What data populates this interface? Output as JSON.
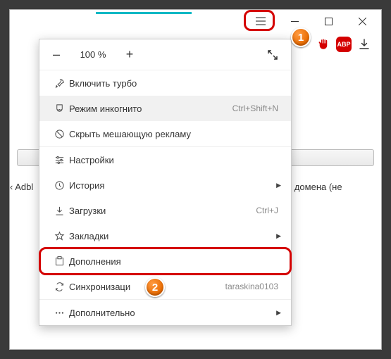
{
  "window": {
    "tab_active": true
  },
  "toolbar": {
    "abp_label": "ABP"
  },
  "zoom": {
    "minus": "–",
    "value": "100 %",
    "plus": "+"
  },
  "menu": {
    "turbo": "Включить турбо",
    "incognito": "Режим инкогнито",
    "incognito_shortcut": "Ctrl+Shift+N",
    "hide_ads": "Скрыть мешающую рекламу",
    "settings": "Настройки",
    "history": "История",
    "downloads": "Загрузки",
    "downloads_shortcut": "Ctrl+J",
    "bookmarks": "Закладки",
    "addons": "Дополнения",
    "sync": "Синхронизаци",
    "sync_user": "taraskina0103",
    "more": "Дополнительно"
  },
  "page_bg": {
    "left_text": "‹ Adbl",
    "right_text": "е домена (не"
  },
  "callouts": {
    "b1": "1",
    "b2": "2"
  }
}
